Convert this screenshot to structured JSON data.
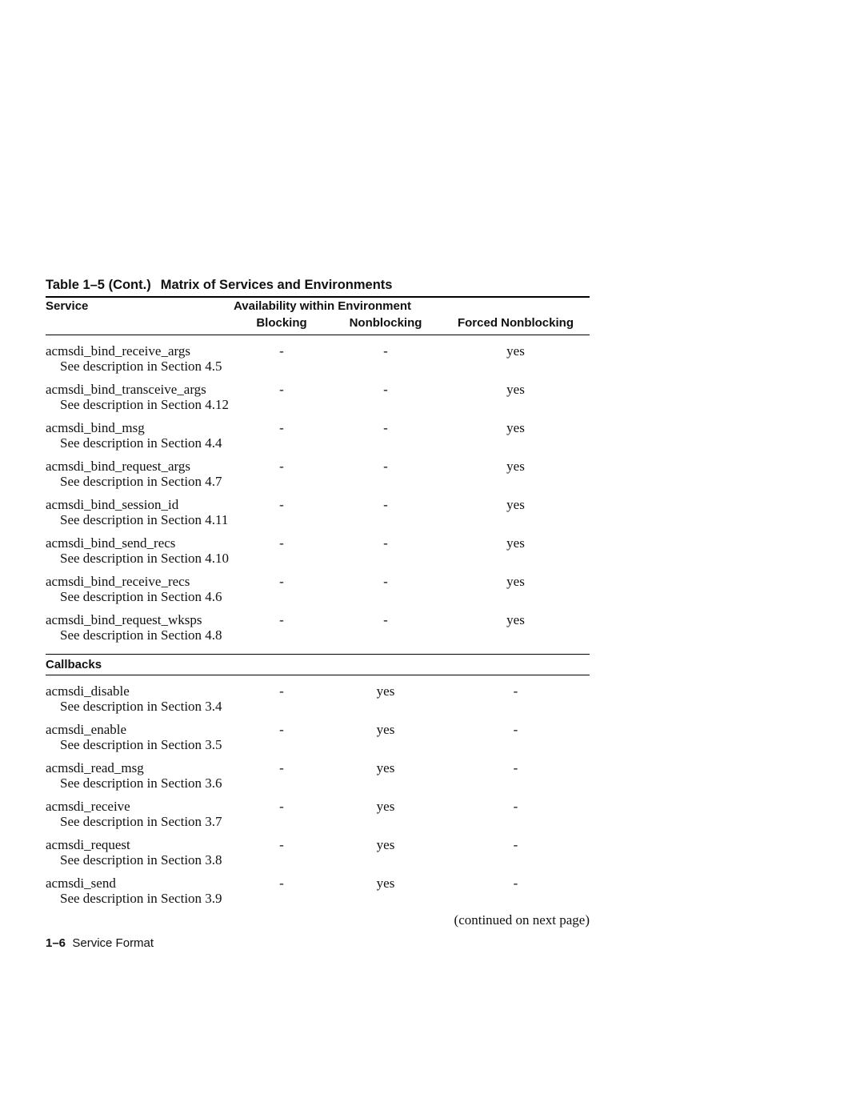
{
  "table": {
    "title_prefix": "Table 1–5 (Cont.)",
    "title_main": "Matrix of Services and Environments",
    "headers": {
      "service": "Service",
      "availability": "Availability within Environment",
      "blocking": "Blocking",
      "nonblocking": "Nonblocking",
      "forced": "Forced Nonblocking"
    },
    "section1_rows": [
      {
        "name": "acmsdi_bind_receive_args",
        "desc": "See description in Section 4.5",
        "blocking": "-",
        "nonblocking": "-",
        "forced": "yes"
      },
      {
        "name": "acmsdi_bind_transceive_args",
        "desc": "See description in Section 4.12",
        "blocking": "-",
        "nonblocking": "-",
        "forced": "yes"
      },
      {
        "name": "acmsdi_bind_msg",
        "desc": "See description in Section 4.4",
        "blocking": "-",
        "nonblocking": "-",
        "forced": "yes"
      },
      {
        "name": "acmsdi_bind_request_args",
        "desc": "See description in Section 4.7",
        "blocking": "-",
        "nonblocking": "-",
        "forced": "yes"
      },
      {
        "name": "acmsdi_bind_session_id",
        "desc": "See description in Section 4.11",
        "blocking": "-",
        "nonblocking": "-",
        "forced": "yes"
      },
      {
        "name": "acmsdi_bind_send_recs",
        "desc": "See description in Section 4.10",
        "blocking": "-",
        "nonblocking": "-",
        "forced": "yes"
      },
      {
        "name": "acmsdi_bind_receive_recs",
        "desc": "See description in Section 4.6",
        "blocking": "-",
        "nonblocking": "-",
        "forced": "yes"
      },
      {
        "name": "acmsdi_bind_request_wksps",
        "desc": "See description in Section 4.8",
        "blocking": "-",
        "nonblocking": "-",
        "forced": "yes"
      }
    ],
    "section2_label": "Callbacks",
    "section2_rows": [
      {
        "name": "acmsdi_disable",
        "desc": "See description in Section 3.4",
        "blocking": "-",
        "nonblocking": "yes",
        "forced": "-"
      },
      {
        "name": "acmsdi_enable",
        "desc": "See description in Section 3.5",
        "blocking": "-",
        "nonblocking": "yes",
        "forced": "-"
      },
      {
        "name": "acmsdi_read_msg",
        "desc": "See description in Section 3.6",
        "blocking": "-",
        "nonblocking": "yes",
        "forced": "-"
      },
      {
        "name": "acmsdi_receive",
        "desc": "See description in Section 3.7",
        "blocking": "-",
        "nonblocking": "yes",
        "forced": "-"
      },
      {
        "name": "acmsdi_request",
        "desc": "See description in Section 3.8",
        "blocking": "-",
        "nonblocking": "yes",
        "forced": "-"
      },
      {
        "name": "acmsdi_send",
        "desc": "See description in Section 3.9",
        "blocking": "-",
        "nonblocking": "yes",
        "forced": "-"
      }
    ],
    "continued": "(continued on next page)"
  },
  "footer": {
    "page_number": "1–6",
    "section_title": "Service Format"
  }
}
